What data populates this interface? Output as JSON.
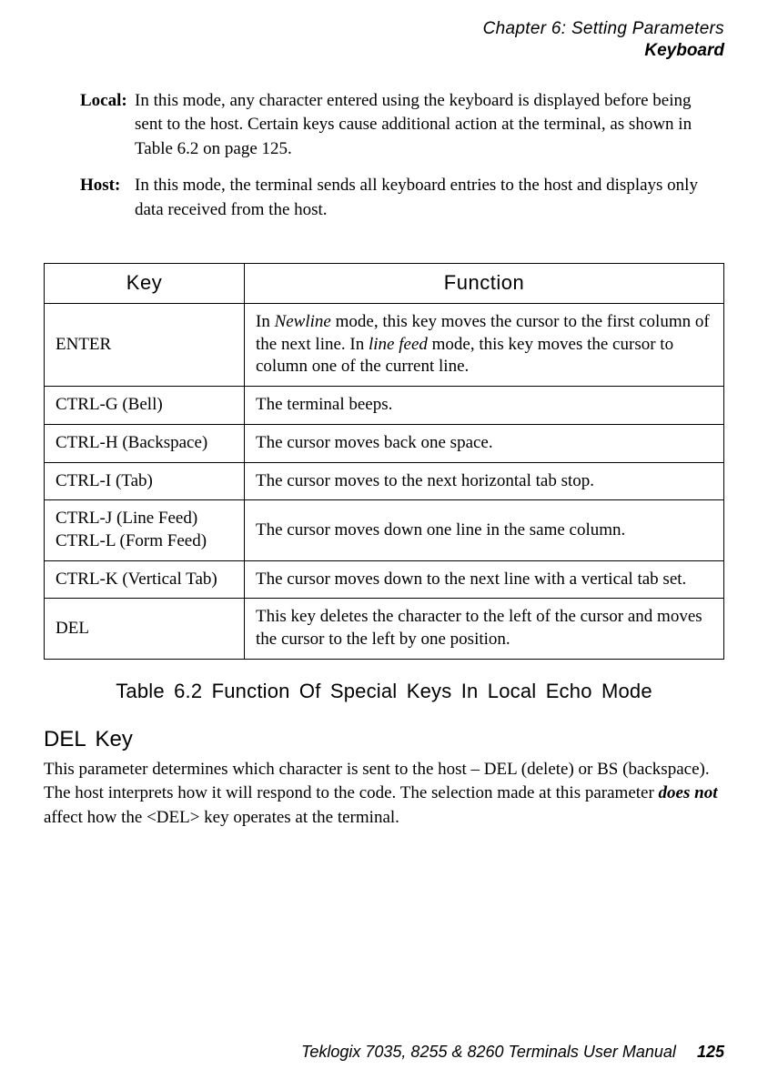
{
  "header": {
    "chapter": "Chapter 6: Setting Parameters",
    "section": "Keyboard"
  },
  "definitions": [
    {
      "term": "Local:",
      "desc": "In this mode, any character entered using the keyboard is displayed before being sent to the host. Certain keys cause additional action at the terminal, as shown in Table 6.2 on page 125."
    },
    {
      "term": "Host:",
      "desc": "In this mode, the terminal sends all keyboard entries to the host and displays only data received from the host."
    }
  ],
  "table": {
    "headers": [
      "Key",
      "Function"
    ],
    "rows": [
      {
        "key": "ENTER",
        "func_parts": [
          {
            "t": "In "
          },
          {
            "t": "Newline",
            "i": true
          },
          {
            "t": " mode, this key moves the cursor to the first column of the next line. In "
          },
          {
            "t": "line feed",
            "i": true
          },
          {
            "t": " mode, this key moves the cursor to column one of the current line."
          }
        ]
      },
      {
        "key": "CTRL-G (Bell)",
        "func_parts": [
          {
            "t": "The terminal beeps."
          }
        ]
      },
      {
        "key": "CTRL-H (Backspace)",
        "func_parts": [
          {
            "t": "The cursor moves back one space."
          }
        ]
      },
      {
        "key": "CTRL-I (Tab)",
        "func_parts": [
          {
            "t": "The cursor moves to the next horizontal tab stop."
          }
        ]
      },
      {
        "key_lines": [
          "CTRL-J (Line Feed)",
          "CTRL-L (Form Feed)"
        ],
        "func_parts": [
          {
            "t": "The cursor moves down one line in the same column."
          }
        ]
      },
      {
        "key": "CTRL-K (Vertical Tab)",
        "func_parts": [
          {
            "t": "The cursor moves down to the next line with a vertical tab set."
          }
        ]
      },
      {
        "key": "DEL",
        "func_parts": [
          {
            "t": "This key deletes the character to the left of the cursor and moves the cursor to the left by one position."
          }
        ]
      }
    ]
  },
  "table_caption": "Table 6.2  Function Of Special Keys In Local Echo Mode",
  "section_heading": "DEL Key",
  "body_parts": [
    {
      "t": "This parameter determines which character is sent to the host – DEL (delete) or BS (backspace). The host interprets how it will respond to the code. The selection made at this parameter "
    },
    {
      "t": "does not",
      "bi": true
    },
    {
      "t": " affect how the <DEL> key operates at the terminal."
    }
  ],
  "footer": {
    "manual": "Teklogix 7035, 8255 & 8260 Terminals User Manual",
    "page": "125"
  }
}
